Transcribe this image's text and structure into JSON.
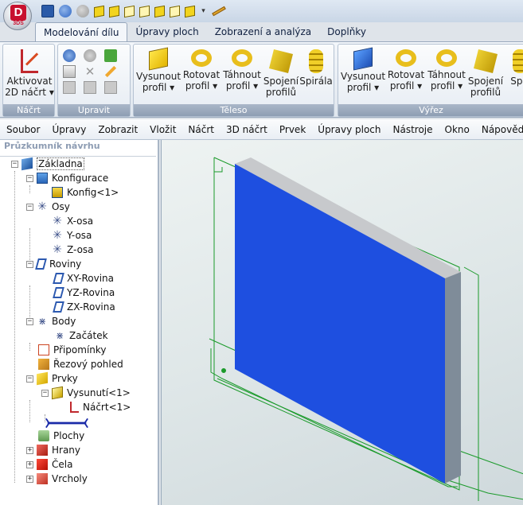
{
  "app": {
    "logo_letter": "D",
    "logo_sub": "3DS"
  },
  "quick_access": {
    "icons": [
      "save-icon",
      "undo-icon",
      "redo-icon",
      "view-front-icon",
      "view-back-icon",
      "view-left-icon",
      "view-right-icon",
      "view-top-icon",
      "view-bottom-icon",
      "view-iso-icon",
      "dropdown-icon",
      "measure-icon"
    ]
  },
  "tabs": [
    {
      "label": "Modelování dílu",
      "active": true
    },
    {
      "label": "Úpravy ploch",
      "active": false
    },
    {
      "label": "Zobrazení a analýza",
      "active": false
    },
    {
      "label": "Doplňky",
      "active": false
    }
  ],
  "ribbon": {
    "groups": {
      "sketch": {
        "label": "Náčrt",
        "activate": {
          "line1": "Aktivovat",
          "line2": "2D náčrt",
          "icon": "sketch-icon"
        }
      },
      "edit": {
        "label": "Upravit"
      },
      "solid": {
        "label": "Těleso",
        "buttons": [
          {
            "line1": "Vysunout",
            "line2": "profil",
            "icon": "extrude-icon"
          },
          {
            "line1": "Rotovat",
            "line2": "profil",
            "icon": "revolve-icon"
          },
          {
            "line1": "Táhnout",
            "line2": "profil",
            "icon": "sweep-icon"
          },
          {
            "line1": "Spojení",
            "line2": "profilů",
            "icon": "loft-icon"
          },
          {
            "line1": "Spirála",
            "line2": "",
            "icon": "helix-icon"
          }
        ]
      },
      "cut": {
        "label": "Výřez",
        "buttons": [
          {
            "line1": "Vysunout",
            "line2": "profil",
            "icon": "extrude-cut-icon"
          },
          {
            "line1": "Rotovat",
            "line2": "profil",
            "icon": "revolve-cut-icon"
          },
          {
            "line1": "Táhnout",
            "line2": "profil",
            "icon": "sweep-cut-icon"
          },
          {
            "line1": "Spojení",
            "line2": "profilů",
            "icon": "loft-cut-icon"
          },
          {
            "line1": "Spir",
            "line2": "",
            "icon": "helix-cut-icon"
          }
        ]
      }
    }
  },
  "menu": [
    "Soubor",
    "Úpravy",
    "Zobrazit",
    "Vložit",
    "Náčrt",
    "3D náčrt",
    "Prvek",
    "Úpravy ploch",
    "Nástroje",
    "Okno",
    "Nápověda"
  ],
  "explorer": {
    "title": "Průzkumník návrhu",
    "nodes": [
      {
        "label": "Základna",
        "exp": "−"
      },
      {
        "label": "Konfigurace",
        "exp": "−"
      },
      {
        "label": "Konfig<1>"
      },
      {
        "label": "Osy",
        "exp": "−"
      },
      {
        "label": "X-osa"
      },
      {
        "label": "Y-osa"
      },
      {
        "label": "Z-osa"
      },
      {
        "label": "Roviny",
        "exp": "−"
      },
      {
        "label": "XY-Rovina"
      },
      {
        "label": "YZ-Rovina"
      },
      {
        "label": "ZX-Rovina"
      },
      {
        "label": "Body",
        "exp": "−"
      },
      {
        "label": "Začátek"
      },
      {
        "label": "Připomínky"
      },
      {
        "label": "Řezový pohled"
      },
      {
        "label": "Prvky",
        "exp": "−"
      },
      {
        "label": "Vysunutí<1>",
        "exp": "−"
      },
      {
        "label": "Náčrt<1>"
      },
      {
        "label": "Plochy"
      },
      {
        "label": "Hrany",
        "exp": "+"
      },
      {
        "label": "Čela",
        "exp": "+"
      },
      {
        "label": "Vrcholy",
        "exp": "+"
      }
    ]
  },
  "model": {
    "front_color": "#1e4fe0",
    "top_color": "#c7c9cc",
    "side_color": "#7f8c99",
    "edge_color": "#1a9a2a"
  }
}
